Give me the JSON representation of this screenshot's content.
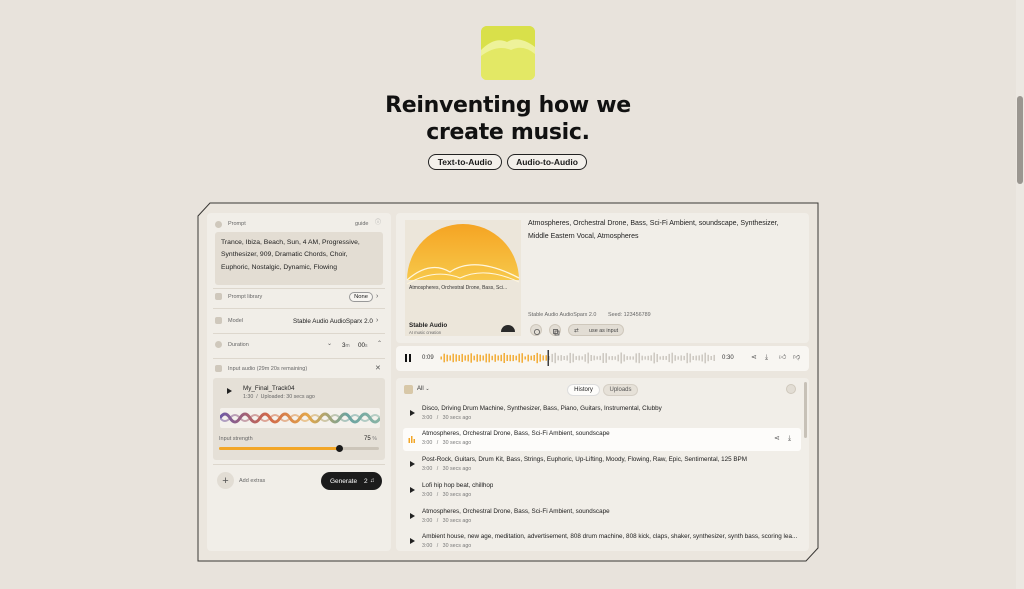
{
  "hero": {
    "title_line1": "Reinventing how we",
    "title_line2": "create music.",
    "pill_text_to_audio": "Text-to-Audio",
    "pill_audio_to_audio": "Audio-to-Audio"
  },
  "left": {
    "prompt_label": "Prompt",
    "guide_label": "guide",
    "prompt_text": "Trance, Ibiza, Beach, Sun, 4 AM, Progressive, Synthesizer, 909, Dramatic Chords, Choir, Euphoric, Nostalgic, Dynamic, Flowing",
    "library_label": "Prompt library",
    "library_value": "None",
    "model_label": "Model",
    "model_value": "Stable Audio AudioSparx 2.0",
    "duration_label": "Duration",
    "duration_min": "3",
    "duration_min_unit": "m",
    "duration_sec": "00",
    "duration_sec_unit": "s",
    "input_audio_label": "Input audio",
    "input_audio_remaining": "(29m 20s remaining)",
    "track_name": "My_Final_Track04",
    "track_length": "1:30",
    "track_uploaded": "Uploaded: 30 secs ago",
    "strength_label": "Input strength",
    "strength_value": "75",
    "strength_unit": "%",
    "strength_fraction": 0.75,
    "add_extras": "Add extras",
    "generate_label": "Generate",
    "generate_credits": "2"
  },
  "result": {
    "cover_caption": "Atmospheres, Orchestral Drone, Bass, Sci...",
    "cover_brand": "Stable Audio",
    "cover_sub": "AI music creation",
    "description": "Atmospheres, Orchestral Drone, Bass, Sci-Fi Ambient, soundscape, Synthesizer, Middle Eastern Vocal, Atmospheres",
    "model": "Stable Audio AudioSparx 2.0",
    "seed": "Seed: 123456789",
    "use_as_input": "use as input",
    "time_current": "0:09",
    "time_total": "0:30",
    "progress_fraction": 0.39
  },
  "history": {
    "filter": "All",
    "tab_history": "History",
    "tab_uploads": "Uploads",
    "items": [
      {
        "title": "Disco, Driving Drum Machine, Synthesizer, Bass, Piano, Guitars, Instrumental, Clubby",
        "length": "3:00",
        "sep": "/",
        "ago": "30 secs ago"
      },
      {
        "title": "Atmospheres, Orchestral Drone, Bass, Sci-Fi Ambient, soundscape",
        "length": "3:00",
        "sep": "/",
        "ago": "30 secs ago"
      },
      {
        "title": "Post-Rock, Guitars, Drum Kit, Bass, Strings, Euphoric, Up-Lifting, Moody, Flowing, Raw, Epic, Sentimental, 125 BPM",
        "length": "3:00",
        "sep": "/",
        "ago": "30 secs ago"
      },
      {
        "title": "Lofi hip hop beat, chillhop",
        "length": "3:00",
        "sep": "/",
        "ago": "30 secs ago"
      },
      {
        "title": "Atmospheres, Orchestral Drone, Bass, Sci-Fi Ambient, soundscape",
        "length": "3:00",
        "sep": "/",
        "ago": "30 secs ago"
      },
      {
        "title": "Ambient house, new age, meditation, advertisement, 808 drum machine, 808 kick, claps, shaker, synthesizer, synth bass, scoring lea...",
        "length": "3:00",
        "sep": "/",
        "ago": "30 secs ago"
      }
    ]
  },
  "colors": {
    "background": "#e8e3dc",
    "accent": "#f2a627",
    "logo": "#d9e04a",
    "dark": "#1c1c1c"
  }
}
